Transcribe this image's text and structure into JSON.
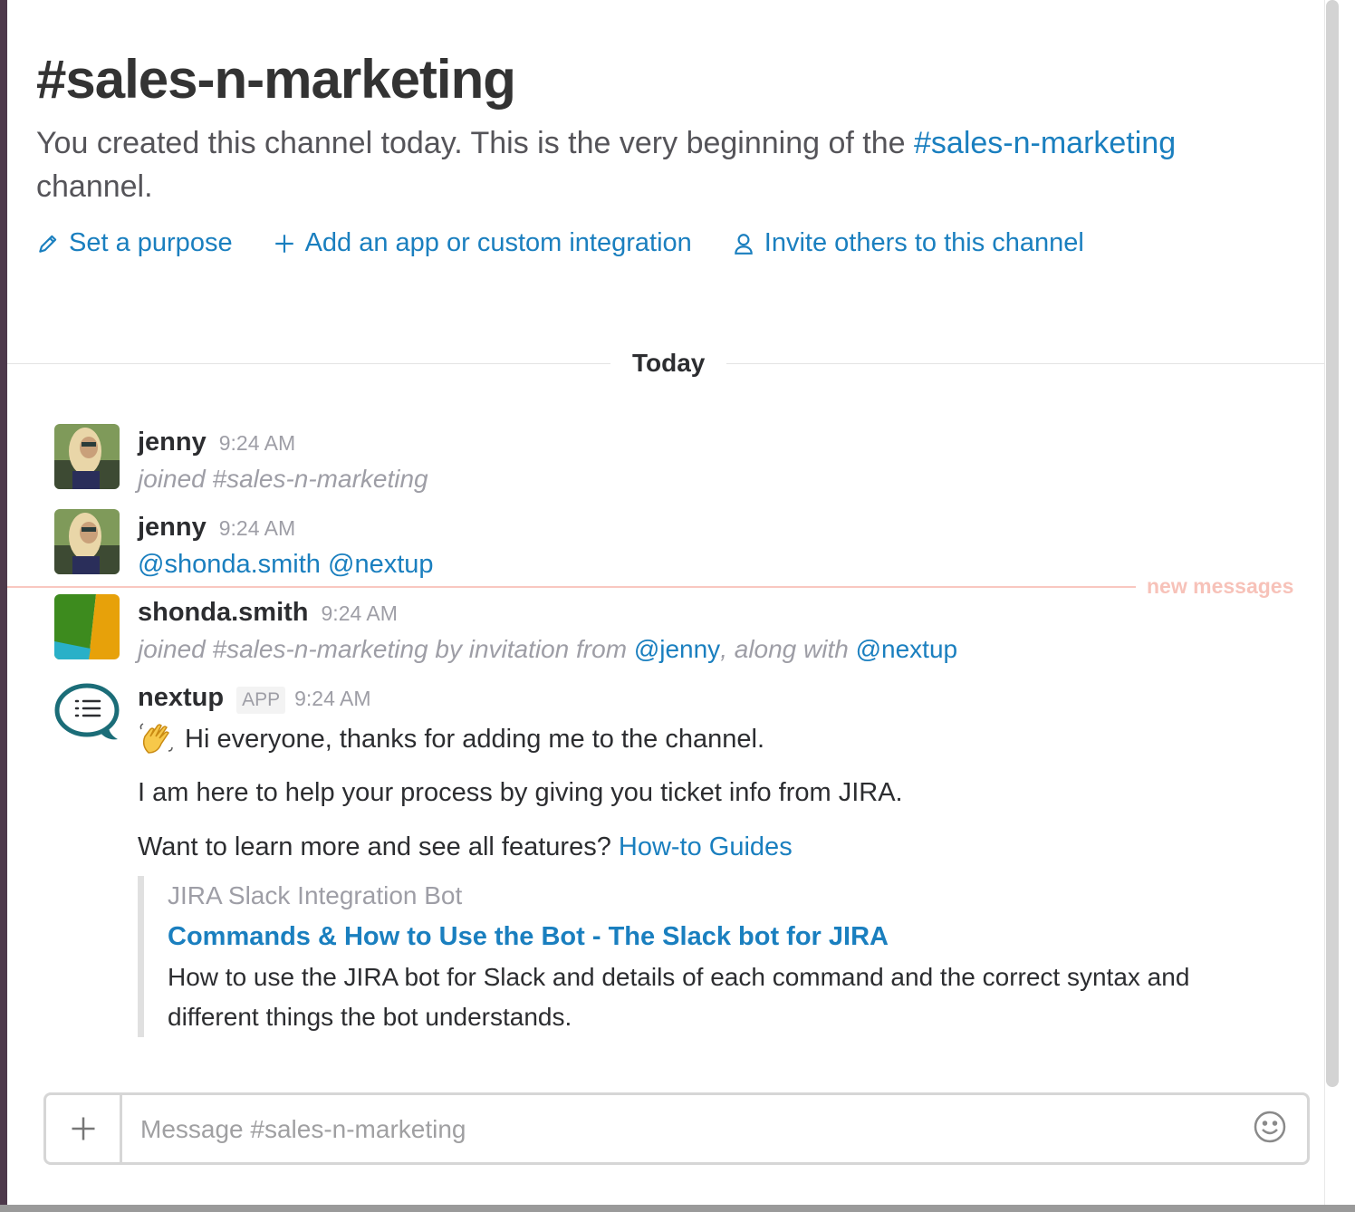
{
  "channel": {
    "title": "#sales-n-marketing",
    "intro_prefix": "You created this channel today. This is the very beginning of the ",
    "intro_link": "#sales-n-marketing",
    "intro_suffix": "channel.",
    "actions": {
      "set_purpose": "Set a purpose",
      "add_app": "Add an app or custom integration",
      "invite": "Invite others to this channel"
    }
  },
  "day_divider": "Today",
  "new_messages_label": "new messages",
  "messages": [
    {
      "user": "jenny",
      "time": "9:24 AM",
      "system": "joined #sales-n-marketing"
    },
    {
      "user": "jenny",
      "time": "9:24 AM",
      "mention1": "@shonda.smith",
      "mention2": "@nextup"
    },
    {
      "user": "shonda.smith",
      "time": "9:24 AM",
      "system_prefix": "joined #sales-n-marketing by invitation from ",
      "mention1": "@jenny",
      "system_middle": ", along with ",
      "mention2": "@nextup"
    },
    {
      "user": "nextup",
      "badge": "APP",
      "time": "9:24 AM",
      "line1": "Hi everyone, thanks for adding me to the channel.",
      "line2": "I am here to help your process by giving you ticket info from JIRA.",
      "line3_prefix": "Want to learn more and see all features? ",
      "line3_link": "How-to Guides",
      "attachment": {
        "service": "JIRA Slack Integration Bot",
        "title": "Commands & How to Use the Bot - The Slack bot for JIRA",
        "description": "How to use the JIRA bot for Slack and details of each command and the correct syntax and different things the bot understands."
      }
    }
  ],
  "composer": {
    "placeholder": "Message #sales-n-marketing"
  },
  "colors": {
    "link": "#1a7fbf",
    "new_messages": "#f7c2b9",
    "sidebar_edge": "#4d394b"
  }
}
